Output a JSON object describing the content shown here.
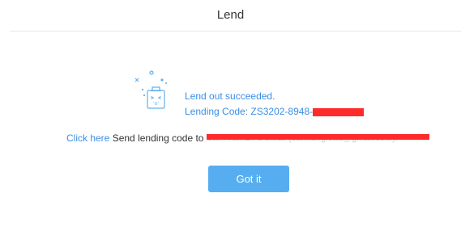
{
  "header": {
    "title": "Lend"
  },
  "success": {
    "icon": "clipboard-face-icon",
    "message": "Lend out succeeded.",
    "code_label": "Lending Code: ZS3202-8948-"
  },
  "send": {
    "link_label": "Click here",
    "text": "Send lending code to",
    "recipient_ghost": "Sam Yan ZY's email (samtanglead@gmail.com)."
  },
  "actions": {
    "got_it_label": "Got it"
  },
  "colors": {
    "accent": "#3a8ee6",
    "button": "#56aef0",
    "redaction": "#ff2a2a"
  }
}
